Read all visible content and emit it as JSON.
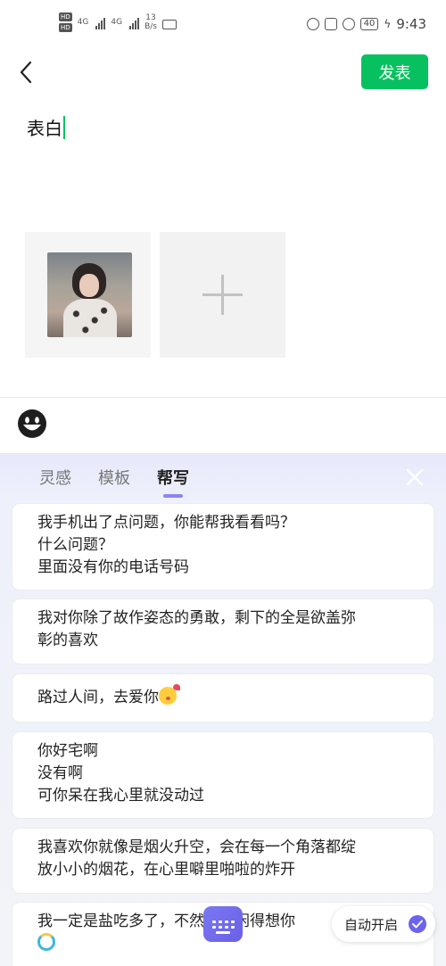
{
  "status_bar": {
    "hd_labels": [
      "HD",
      "HD"
    ],
    "network_label_1": "4G",
    "network_label_2": "4G",
    "net_speed_value": "13",
    "net_speed_unit": "B/s",
    "battery": "40",
    "time": "9:43"
  },
  "header": {
    "publish_label": "发表"
  },
  "composer": {
    "text": "表白"
  },
  "helper_panel": {
    "tabs": [
      {
        "label": "灵感"
      },
      {
        "label": "模板"
      },
      {
        "label": "帮写"
      }
    ],
    "active_tab": "帮写",
    "suggestions": [
      {
        "lines": [
          "我手机出了点问题，你能帮我看看吗？",
          "什么问题？",
          "里面没有你的电话号码"
        ]
      },
      {
        "lines": [
          "我对你除了故作姿态的勇敢，剩下的全是欲盖弥",
          "彰的喜欢"
        ]
      },
      {
        "lines": [
          "路过人间，去爱你"
        ]
      },
      {
        "lines": [
          "你好宅啊",
          "没有啊",
          "可你呆在我心里就没动过"
        ]
      },
      {
        "lines": [
          "我喜欢你就像是烟火升空，会在每一个角落都绽",
          "放小小的烟花，在心里噼里啪啦的炸开"
        ]
      },
      {
        "lines": [
          "我一定是盐吃多了，不然怎么闲得想你"
        ]
      }
    ],
    "auto_start_label": "自动开启"
  },
  "colors": {
    "accent_green": "#07c160",
    "accent_purple": "#6c63ee"
  }
}
